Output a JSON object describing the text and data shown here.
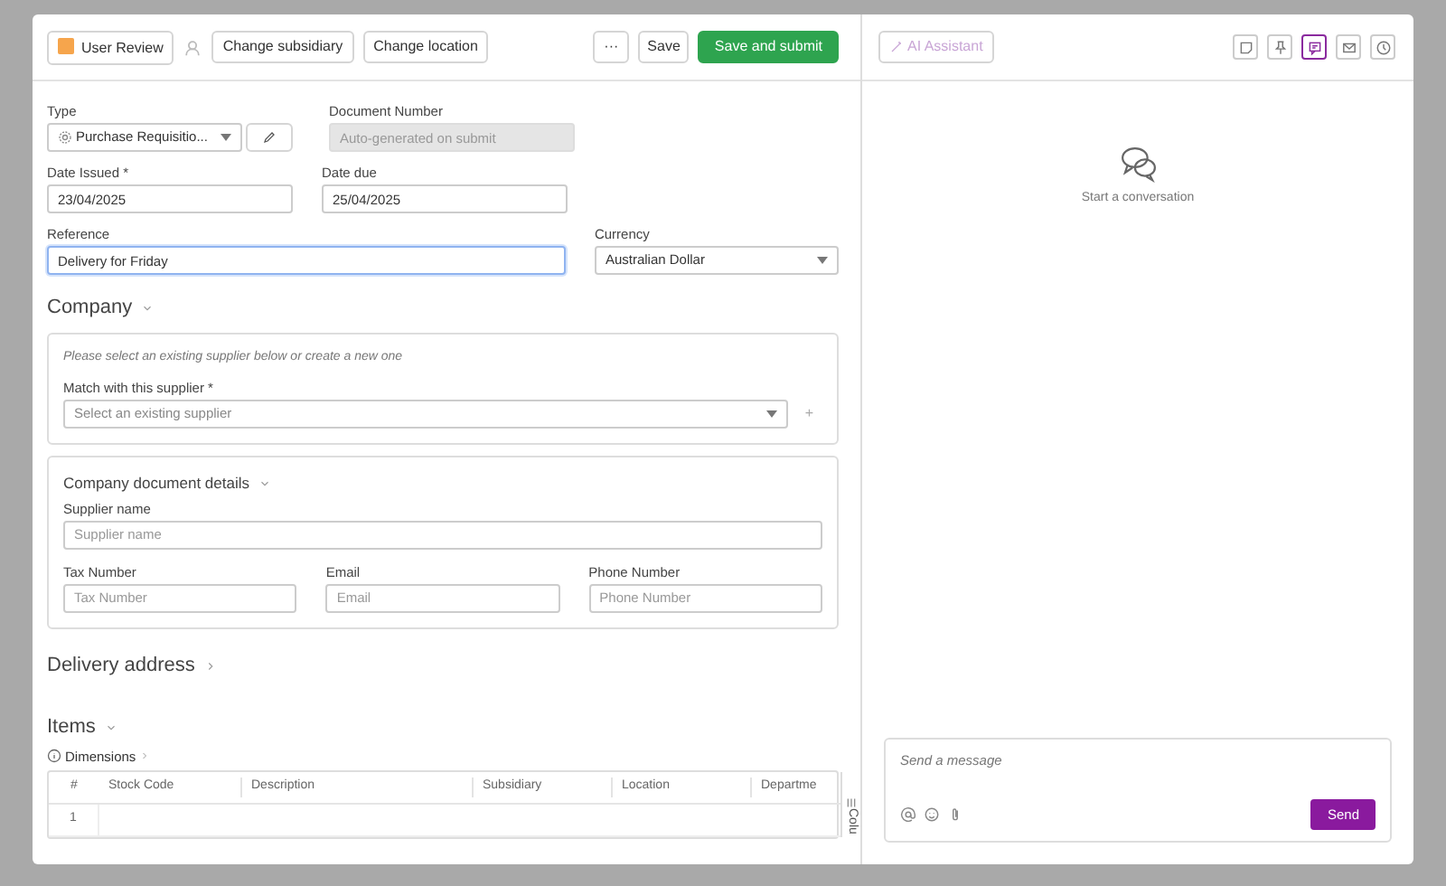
{
  "toolbar": {
    "status": {
      "label": "User Review",
      "color": "#f6a54c"
    },
    "buttons": [
      {
        "label": "Change subsidiary"
      },
      {
        "label": "Change location"
      }
    ],
    "more": "···",
    "save": "Save",
    "submit": "Save and submit"
  },
  "form": {
    "type": {
      "label": "Type",
      "value": "Purchase Requisitio..."
    },
    "document_number": {
      "label": "Document Number",
      "placeholder": "Auto-generated on submit",
      "disabled": true
    },
    "date_issued": {
      "label": "Date Issued *",
      "value": "23/04/2025"
    },
    "date_due": {
      "label": "Date due",
      "value": "25/04/2025"
    },
    "reference": {
      "label": "Reference",
      "value": "Delivery for Friday",
      "focused": true
    },
    "currency": {
      "label": "Currency",
      "value": "Australian Dollar"
    }
  },
  "company": {
    "title": "Company",
    "expanded": true,
    "hint": "Please select an existing supplier below or create a new one",
    "match_label": "Match with this supplier *",
    "match_placeholder": "Select an existing supplier",
    "add": "+",
    "details": {
      "title": "Company document details",
      "expanded": true,
      "fields": [
        {
          "label": "Supplier name",
          "placeholder": "Supplier name"
        },
        {
          "label": "Tax Number",
          "placeholder": "Tax Number"
        },
        {
          "label": "Email",
          "placeholder": "Email"
        },
        {
          "label": "Phone Number",
          "placeholder": "Phone Number"
        }
      ]
    }
  },
  "delivery": {
    "title": "Delivery address",
    "expanded": false
  },
  "items": {
    "title": "Items",
    "expanded": true,
    "dimensions": "Dimensions",
    "columns": [
      "#",
      "Stock Code",
      "Description",
      "Subsidiary",
      "Location",
      "Departme"
    ],
    "rows": [
      [
        "1"
      ]
    ],
    "columns_tab": "Colu"
  },
  "side": {
    "ai_button": "AI Assistant",
    "tools": [
      {
        "kind": "note",
        "selected": false
      },
      {
        "kind": "pin",
        "selected": false
      },
      {
        "kind": "chat",
        "selected": true
      },
      {
        "kind": "mail",
        "selected": false
      },
      {
        "kind": "clock",
        "selected": false
      }
    ],
    "empty_text": "Start a conversation",
    "message_placeholder": "Send a message",
    "send": "Send"
  }
}
